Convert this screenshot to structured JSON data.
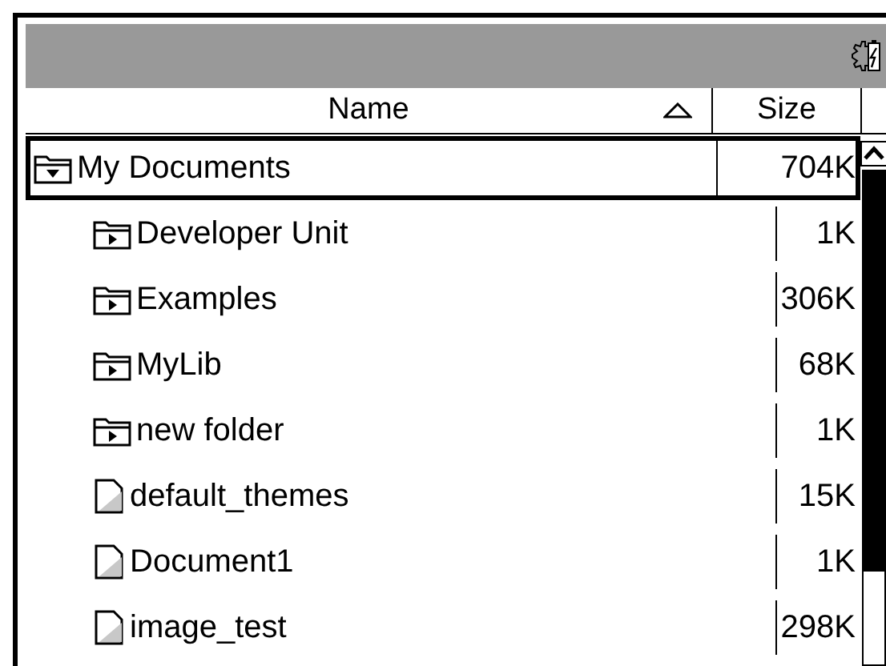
{
  "columns": [
    {
      "label": "Name",
      "sorted": true
    },
    {
      "label": "Size",
      "sorted": false
    }
  ],
  "tree": [
    {
      "name": "My Documents",
      "size": "704K",
      "kind": "folder",
      "expanded": true,
      "selected": true,
      "children": [
        {
          "name": "Developer Unit",
          "size": "1K",
          "kind": "folder",
          "expanded": false,
          "selected": false
        },
        {
          "name": "Examples",
          "size": "306K",
          "kind": "folder",
          "expanded": false,
          "selected": false
        },
        {
          "name": "MyLib",
          "size": "68K",
          "kind": "folder",
          "expanded": false,
          "selected": false
        },
        {
          "name": "new folder",
          "size": "1K",
          "kind": "folder",
          "expanded": false,
          "selected": false
        },
        {
          "name": "default_themes",
          "size": "15K",
          "kind": "file",
          "selected": false
        },
        {
          "name": "Document1",
          "size": "1K",
          "kind": "file",
          "selected": false
        },
        {
          "name": "image_test",
          "size": "298K",
          "kind": "file",
          "selected": false
        }
      ]
    }
  ]
}
